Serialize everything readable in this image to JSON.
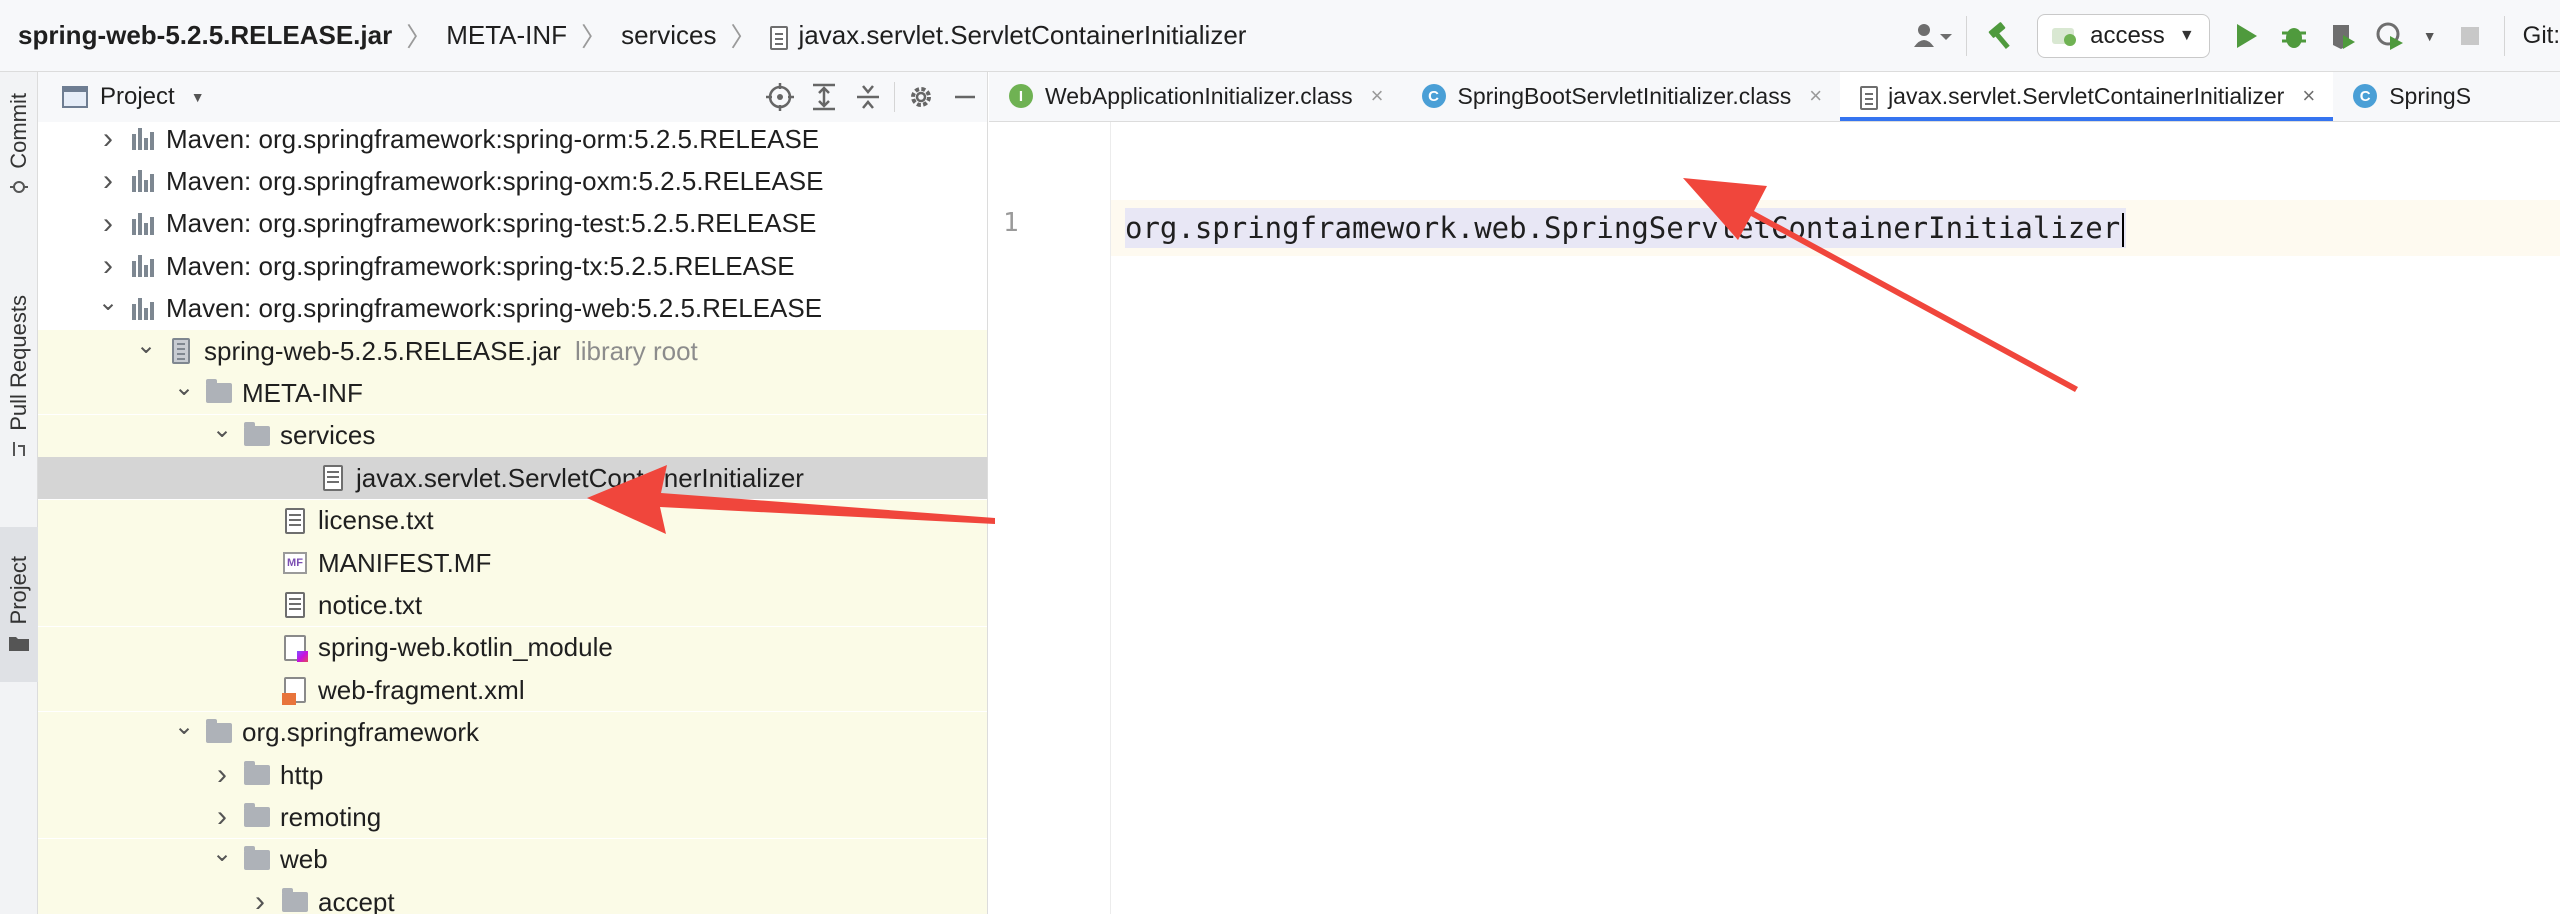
{
  "navbar": {
    "breadcrumbs": [
      "spring-web-5.2.5.RELEASE.jar",
      "META-INF",
      "services",
      "javax.servlet.ServletContainerInitializer"
    ],
    "run_config": "access",
    "git_label": "Git:"
  },
  "toolstrip": {
    "commit": "Commit",
    "pull_requests": "Pull Requests",
    "project": "Project"
  },
  "project_panel": {
    "title": "Project",
    "tree": [
      {
        "label": "Maven: org.springframework:spring-orm:5.2.5.RELEASE",
        "icon": "maven-library-icon",
        "expanded": false
      },
      {
        "label": "Maven: org.springframework:spring-oxm:5.2.5.RELEASE",
        "icon": "maven-library-icon",
        "expanded": false
      },
      {
        "label": "Maven: org.springframework:spring-test:5.2.5.RELEASE",
        "icon": "maven-library-icon",
        "expanded": false
      },
      {
        "label": "Maven: org.springframework:spring-tx:5.2.5.RELEASE",
        "icon": "maven-library-icon",
        "expanded": false
      },
      {
        "label": "Maven: org.springframework:spring-web:5.2.5.RELEASE",
        "icon": "maven-library-icon",
        "expanded": true
      },
      {
        "label": "spring-web-5.2.5.RELEASE.jar",
        "sub": "library root",
        "icon": "jar-icon",
        "expanded": true
      },
      {
        "label": "META-INF",
        "icon": "folder-icon",
        "expanded": true
      },
      {
        "label": "services",
        "icon": "folder-icon",
        "expanded": true
      },
      {
        "label": "javax.servlet.ServletContainerInitializer",
        "icon": "text-file-icon",
        "selected": true
      },
      {
        "label": "license.txt",
        "icon": "text-file-icon"
      },
      {
        "label": "MANIFEST.MF",
        "icon": "manifest-file-icon"
      },
      {
        "label": "notice.txt",
        "icon": "text-file-icon"
      },
      {
        "label": "spring-web.kotlin_module",
        "icon": "kotlin-module-icon"
      },
      {
        "label": "web-fragment.xml",
        "icon": "xml-file-icon"
      },
      {
        "label": "org.springframework",
        "icon": "folder-icon",
        "expanded": true
      },
      {
        "label": "http",
        "icon": "folder-icon",
        "expanded": false
      },
      {
        "label": "remoting",
        "icon": "folder-icon",
        "expanded": false
      },
      {
        "label": "web",
        "icon": "folder-icon",
        "expanded": true
      },
      {
        "label": "accept",
        "icon": "folder-icon",
        "expanded": false
      }
    ]
  },
  "editor": {
    "tabs": [
      {
        "label": "WebApplicationInitializer.class",
        "icon": "interface-icon",
        "glyph": "I"
      },
      {
        "label": "SpringBootServletInitializer.class",
        "icon": "class-icon",
        "glyph": "C"
      },
      {
        "label": "javax.servlet.ServletContainerInitializer",
        "icon": "text-file-icon",
        "active": true
      },
      {
        "label": "SpringS",
        "icon": "class-icon",
        "glyph": "C"
      }
    ],
    "line_number": "1",
    "code_line": "org.springframework.web.SpringServletContainerInitializer"
  },
  "colors": {
    "accent": "#3574f0",
    "arrow": "#f0463c",
    "library_highlight": "#fbfbe7",
    "selection": "#d5d5d5"
  }
}
